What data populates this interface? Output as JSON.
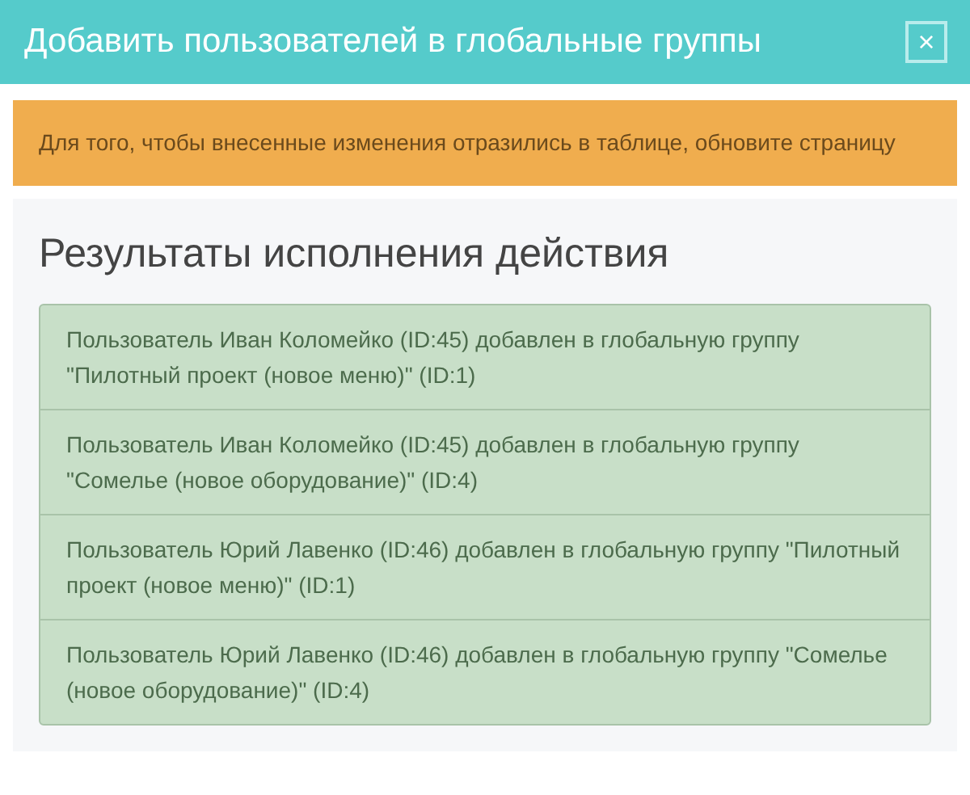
{
  "dialog": {
    "title": "Добавить пользователей в глобальные группы",
    "close": "×"
  },
  "alert": {
    "text": "Для того, чтобы внесенные изменения отразились в таблице, обновите страницу"
  },
  "results": {
    "heading": "Результаты исполнения действия",
    "items": [
      {
        "text": "Пользователь Иван Коломейко (ID:45) добавлен в глобальную группу \"Пилотный проект (новое меню)\" (ID:1)"
      },
      {
        "text": "Пользователь Иван Коломейко (ID:45) добавлен в глобальную группу \"Сомелье (новое оборудование)\" (ID:4)"
      },
      {
        "text": "Пользователь Юрий Лавенко (ID:46) добавлен в глобальную группу \"Пилотный проект (новое меню)\" (ID:1)"
      },
      {
        "text": "Пользователь Юрий Лавенко (ID:46) добавлен в глобальную группу \"Сомелье (новое оборудование)\" (ID:4)"
      }
    ]
  }
}
